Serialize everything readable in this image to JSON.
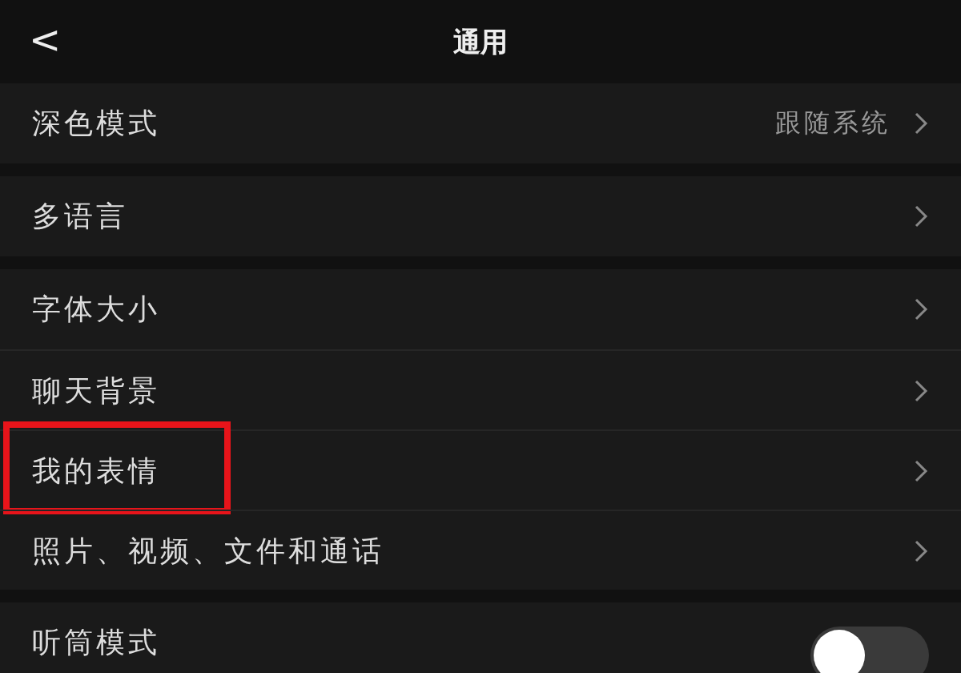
{
  "header": {
    "back": "<",
    "title": "通用"
  },
  "groups": [
    {
      "items": [
        {
          "kind": "link",
          "label": "深色模式",
          "value": "跟随系统",
          "highlighted": false
        }
      ]
    },
    {
      "items": [
        {
          "kind": "link",
          "label": "多语言",
          "highlighted": false
        }
      ]
    },
    {
      "items": [
        {
          "kind": "link",
          "label": "字体大小",
          "highlighted": false
        },
        {
          "kind": "link",
          "label": "聊天背景",
          "highlighted": false
        },
        {
          "kind": "link",
          "label": "我的表情",
          "highlighted": true
        },
        {
          "kind": "link",
          "label": "照片、视频、文件和通话",
          "highlighted": false
        }
      ]
    },
    {
      "items": [
        {
          "kind": "toggle",
          "label": "听筒模式",
          "on": false,
          "highlighted": false
        }
      ]
    }
  ]
}
